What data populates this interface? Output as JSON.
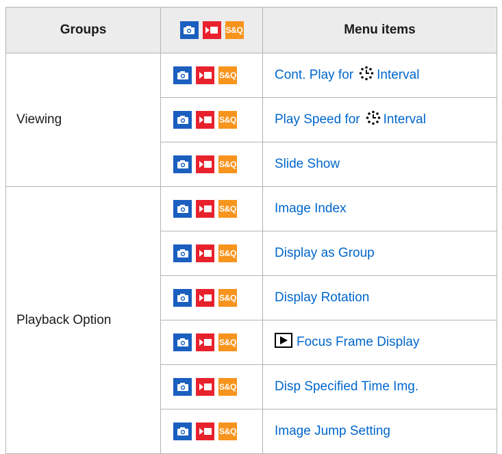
{
  "table": {
    "headers": {
      "groups": "Groups",
      "menu_items": "Menu items"
    },
    "mode_badges": {
      "photo_icon": "camera-icon",
      "movie_icon": "movie-icon",
      "snq_label": "S&Q"
    },
    "groups": [
      {
        "name": "Viewing"
      },
      {
        "name": "Playback Option"
      }
    ],
    "rows": [
      {
        "pre": "Cont. Play for",
        "icon": "interval-icon",
        "post": "Interval"
      },
      {
        "pre": "Play Speed for",
        "icon": "interval-icon",
        "post": "Interval"
      },
      {
        "label": "Slide Show"
      },
      {
        "label": "Image Index"
      },
      {
        "label": "Display as Group"
      },
      {
        "label": "Display Rotation"
      },
      {
        "icon": "playback-icon",
        "label": "Focus Frame Display"
      },
      {
        "label": "Disp Specified Time Img."
      },
      {
        "label": "Image Jump Setting"
      }
    ]
  },
  "colors": {
    "link": "#0066cc",
    "photo_badge": "#1b5fbf",
    "movie_badge": "#e8222d",
    "snq_badge": "#f7941d",
    "header_bg": "#ececec"
  }
}
